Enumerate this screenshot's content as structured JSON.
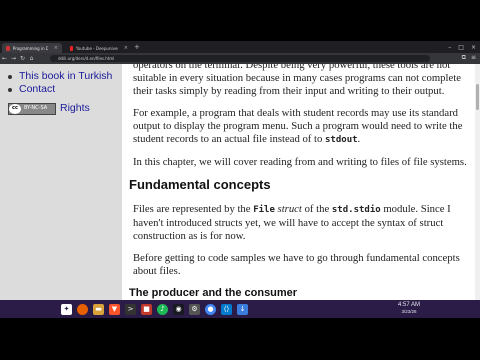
{
  "browser": {
    "tabs": [
      {
        "label": "Programming in D - File",
        "active": true
      },
      {
        "label": "Youtube - Deepuniverse - bash+ c...",
        "active": false
      }
    ],
    "new_tab": "+",
    "url": "ddili.org/ders/d.en/files.html",
    "window_controls": [
      "–",
      "□",
      "×"
    ]
  },
  "sidebar": {
    "items": [
      {
        "label": "This book in Turkish"
      },
      {
        "label": "Contact"
      }
    ],
    "license_badge": "BY-NC-SA",
    "rights_label": "Rights"
  },
  "content": {
    "p1": "operators on the terminal. Despite being very powerful, these tools are not suitable in every situation because in many cases programs can not complete their tasks simply by reading from their input and writing to their output.",
    "p2a": "For example, a program that deals with student records may use its standard output to display the program menu. Such a program would need to write the student records to an actual file instead of to ",
    "p2code": "stdout",
    "p2end": ".",
    "p3": "In this chapter, we will cover reading from and writing to files of file systems.",
    "h_fundamental": "Fundamental concepts",
    "p4a": "Files are represented by the ",
    "p4code1": "File",
    "p4b": " ",
    "p4em": "struct",
    "p4c": " of the ",
    "p4code2": "std.stdio",
    "p4d": " module. Since I haven't introduced structs yet, we will have to accept the syntax of struct construction as is for now.",
    "p5": "Before getting to code samples we have to go through fundamental concepts about files.",
    "h_producer": "The producer and the consumer"
  },
  "taskbar": {
    "icons": [
      "start-icon",
      "firefox-icon",
      "folder-icon",
      "brave-icon",
      "terminal-icon",
      "app-icon",
      "music-icon",
      "steam-icon",
      "settings-icon",
      "chrome-icon",
      "vscode-icon",
      "download-icon"
    ],
    "time": "4:57 AM",
    "date": "3/23/26"
  },
  "colors": {
    "link": "#1a1a9a",
    "sidebar_bg": "#dcdcdc",
    "taskbar_bg": "#2a1b47"
  }
}
